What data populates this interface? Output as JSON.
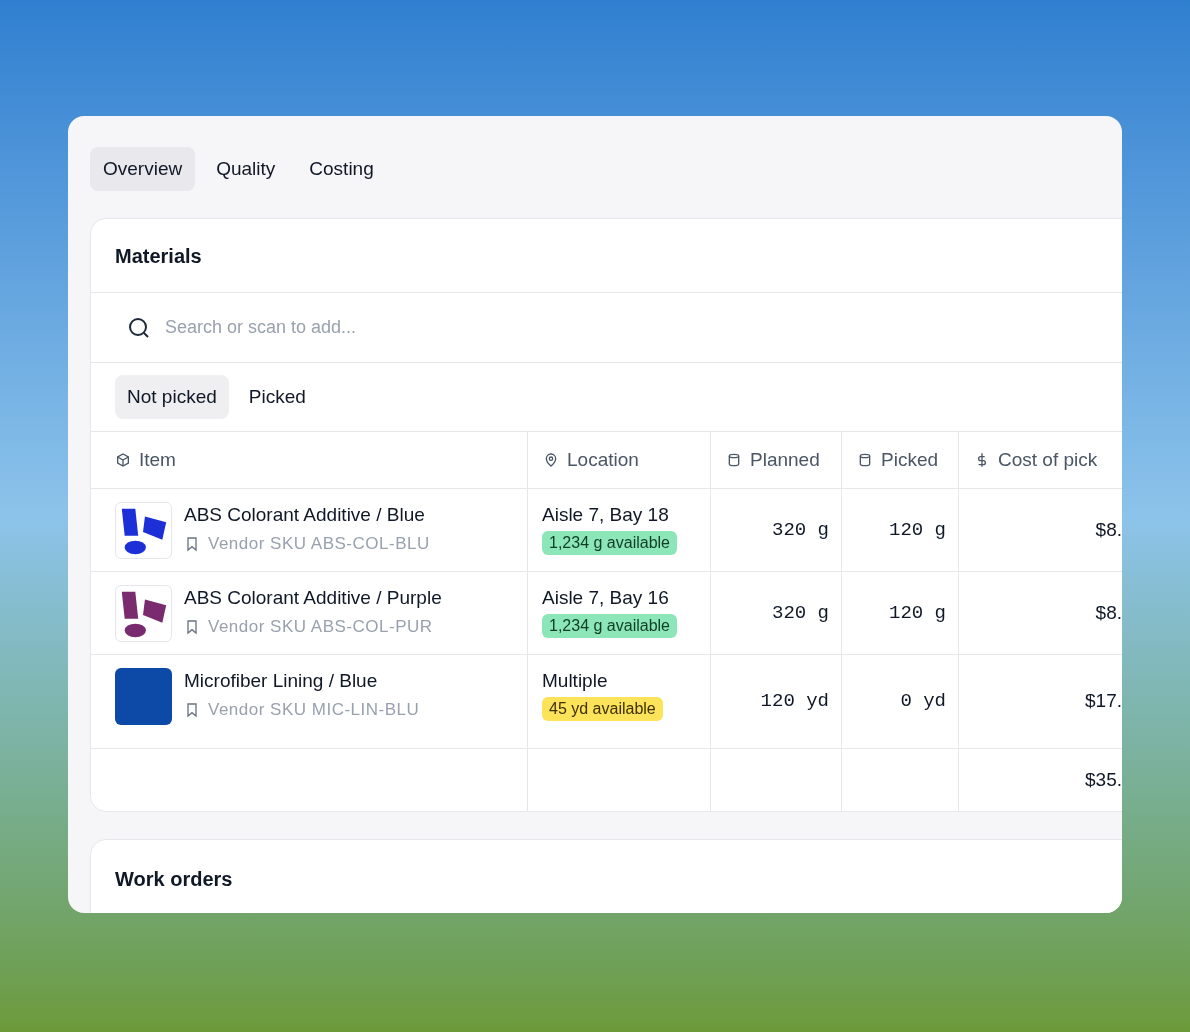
{
  "tabs": [
    {
      "label": "Overview",
      "selected": true
    },
    {
      "label": "Quality",
      "selected": false
    },
    {
      "label": "Costing",
      "selected": false
    }
  ],
  "materials": {
    "title": "Materials",
    "search": {
      "placeholder": "Search or scan to add..."
    },
    "filters": [
      {
        "label": "Not picked",
        "selected": true
      },
      {
        "label": "Picked",
        "selected": false
      }
    ],
    "columns": [
      {
        "label": "Item",
        "kind": "box"
      },
      {
        "label": "Location",
        "kind": "pin"
      },
      {
        "label": "Planned",
        "kind": "cylinder"
      },
      {
        "label": "Picked",
        "kind": "cylinder"
      },
      {
        "label": "Cost of pick",
        "kind": "dollar"
      }
    ],
    "rows": [
      {
        "name": "ABS Colorant Additive / Blue",
        "sku": "Vendor SKU ABS-COL-BLU",
        "kind": "pigment",
        "color": "#1d2fd6",
        "location": "Aisle 7, Bay 18",
        "availability": {
          "text": "1,234 g available",
          "kind": "ok"
        },
        "planned": "320 g",
        "picked": "120 g",
        "cost": "$8."
      },
      {
        "name": "ABS Colorant Additive / Purple",
        "sku": "Vendor SKU ABS-COL-PUR",
        "kind": "pigment",
        "color": "#7a2a6e",
        "location": "Aisle 7, Bay 16",
        "availability": {
          "text": "1,234 g available",
          "kind": "ok"
        },
        "planned": "320 g",
        "picked": "120 g",
        "cost": "$8."
      },
      {
        "name": "Microfiber Lining / Blue",
        "sku": "Vendor SKU MIC-LIN-BLU",
        "kind": "swatch",
        "color": "#0d4aa8",
        "location": "Multiple",
        "availability": {
          "text": "45 yd available",
          "kind": "low"
        },
        "planned": "120 yd",
        "picked": "0 yd",
        "cost": "$17."
      }
    ],
    "total": "$35."
  },
  "work_orders": {
    "title": "Work orders"
  }
}
